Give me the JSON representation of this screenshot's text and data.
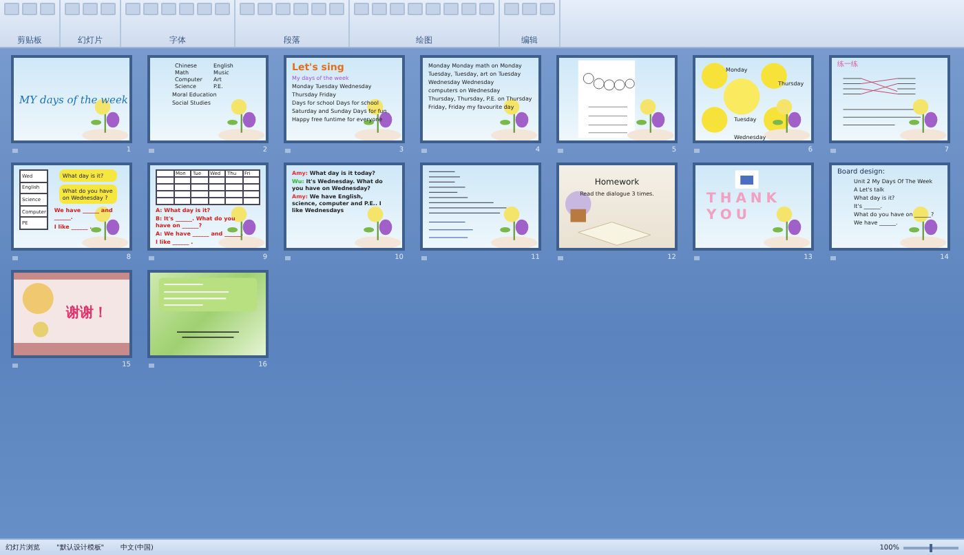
{
  "ribbon": {
    "groups": [
      {
        "label": "剪贴板"
      },
      {
        "label": "幻灯片"
      },
      {
        "label": "字体"
      },
      {
        "label": "段落"
      },
      {
        "label": "绘图"
      },
      {
        "label": "编辑"
      }
    ]
  },
  "slides": [
    {
      "number": "1",
      "kind": "title",
      "items": [
        {
          "kind": "heading",
          "text": "MY days of the week"
        }
      ]
    },
    {
      "number": "2",
      "kind": "sky",
      "grid": [
        "Chinese",
        "English",
        "Math",
        "Music",
        "Computer",
        "Art",
        "Science",
        "P.E."
      ],
      "items": [
        {
          "kind": "indent",
          "text": "Moral Education"
        },
        {
          "kind": "indent",
          "text": "Social Studies"
        }
      ]
    },
    {
      "number": "3",
      "kind": "sky",
      "items": [
        {
          "kind": "sing",
          "text": "Let's sing"
        },
        {
          "kind": "sub",
          "text": "My days of the week"
        },
        {
          "kind": "line",
          "text": "Monday Tuesday Wednesday"
        },
        {
          "kind": "line",
          "text": "Thursday Friday"
        },
        {
          "kind": "line",
          "text": "Days for school Days for school"
        },
        {
          "kind": "line",
          "text": "Saturday and Sunday Days for fun"
        },
        {
          "kind": "line",
          "text": "Happy free funtime for everyone"
        }
      ]
    },
    {
      "number": "4",
      "kind": "sky",
      "items": [
        {
          "kind": "line",
          "text": "Monday Monday math on Monday"
        },
        {
          "kind": "line",
          "text": "Tuesday, Tuesday, art on Tuesday"
        },
        {
          "kind": "line",
          "text": "Wednesday Wednesday"
        },
        {
          "kind": "line",
          "text": "computers on Wednesday"
        },
        {
          "kind": "line",
          "text": "Thursday, Thursday, P.E. on Thursday"
        },
        {
          "kind": "line",
          "text": "Friday, Friday my favourite day"
        }
      ]
    },
    {
      "number": "5",
      "kind": "worksheet"
    },
    {
      "number": "6",
      "kind": "suns",
      "items": [
        {
          "kind": "label",
          "text": "Monday"
        },
        {
          "kind": "label",
          "text": "Thursday"
        },
        {
          "kind": "label",
          "text": "Tuesday"
        },
        {
          "kind": "label",
          "text": "Wednesday"
        }
      ]
    },
    {
      "number": "7",
      "kind": "match",
      "items": [
        {
          "kind": "pinkhead",
          "text": "练一练"
        }
      ]
    },
    {
      "number": "8",
      "kind": "table-side",
      "column": [
        "Wed",
        "English",
        "Science",
        "Computer",
        "PE"
      ],
      "items": [
        {
          "kind": "bubble",
          "text": "What day is it?"
        },
        {
          "kind": "bubble",
          "text": "What do you have on Wednesday ?"
        },
        {
          "kind": "red",
          "text": "We have ______ and ______."
        },
        {
          "kind": "red",
          "text": "I like ______ ."
        }
      ]
    },
    {
      "number": "9",
      "kind": "table-top",
      "header": [
        "Mon",
        "Tue",
        "Wed",
        "Thu",
        "Fri"
      ],
      "items": [
        {
          "kind": "red",
          "text": "A: What day is it?"
        },
        {
          "kind": "red",
          "text": "B: It's ______. What do you have on ______?"
        },
        {
          "kind": "red",
          "text": "A: We have ______ and ______."
        },
        {
          "kind": "red",
          "text": "I like ______ ."
        }
      ]
    },
    {
      "number": "10",
      "kind": "sky",
      "items": [
        {
          "kind": "speaker",
          "who": "Amy:",
          "color": "#e03030",
          "text": "What day is it today?"
        },
        {
          "kind": "speaker",
          "who": "Wu:",
          "color": "#30b030",
          "text": "It's Wednesday. What do you have on Wednesday?"
        },
        {
          "kind": "speaker",
          "who": "Amy:",
          "color": "#e03030",
          "text": "We have English, science, computer and P.E.. I like Wednesdays"
        }
      ]
    },
    {
      "number": "11",
      "kind": "notes"
    },
    {
      "number": "12",
      "kind": "paper",
      "items": [
        {
          "kind": "big",
          "text": "Homework"
        },
        {
          "kind": "center",
          "text": "Read the dialogue 3 times."
        }
      ]
    },
    {
      "number": "13",
      "kind": "thanks",
      "items": [
        {
          "kind": "letters",
          "text": "THANK"
        },
        {
          "kind": "letters",
          "text": "YOU"
        }
      ]
    },
    {
      "number": "14",
      "kind": "sky",
      "items": [
        {
          "kind": "board",
          "text": "Board design:"
        },
        {
          "kind": "indent",
          "text": "Unit 2 My Days Of The Week"
        },
        {
          "kind": "indent",
          "text": "A Let's talk"
        },
        {
          "kind": "indent",
          "text": "What day is it?"
        },
        {
          "kind": "indent",
          "text": "It's ______."
        },
        {
          "kind": "indent",
          "text": "What do you have on ______?"
        },
        {
          "kind": "indent",
          "text": "We have ______."
        }
      ]
    },
    {
      "number": "15",
      "kind": "pink",
      "items": [
        {
          "kind": "cn",
          "text": "谢谢！"
        }
      ]
    },
    {
      "number": "16",
      "kind": "green"
    }
  ],
  "status_bar": {
    "items": [
      "幻灯片浏览",
      "\"默认设计模板\"",
      "中文(中国)"
    ],
    "zoom": "100%",
    "zoom_slider": {
      "level": 0.5
    }
  }
}
